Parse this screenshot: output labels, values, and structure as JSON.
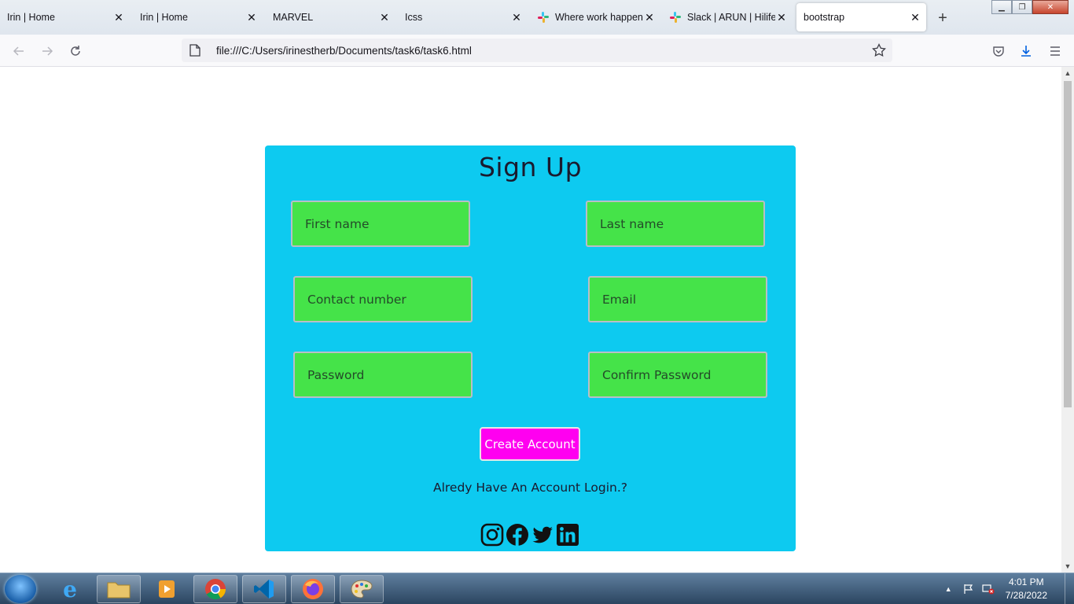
{
  "browser": {
    "tabs": [
      {
        "title": "Irin | Home",
        "active": false
      },
      {
        "title": "Irin | Home",
        "active": false
      },
      {
        "title": "MARVEL",
        "active": false
      },
      {
        "title": "Icss",
        "active": false
      },
      {
        "title": "Where work happens",
        "active": false
      },
      {
        "title": "Slack | ARUN | HilifeAI",
        "active": false
      },
      {
        "title": "bootstrap",
        "active": true
      }
    ],
    "url": "file:///C:/Users/irinestherb/Documents/task6/task6.html"
  },
  "signup": {
    "title": "Sign Up",
    "fields": {
      "first_name": "First name",
      "last_name": "Last name",
      "contact": "Contact number",
      "email": "Email",
      "password": "Password",
      "confirm_password": "Confirm Password"
    },
    "create_button": "Create Account",
    "login_text": "Alredy Have An Account Login.?",
    "social_icons": [
      "instagram-icon",
      "facebook-icon",
      "twitter-icon",
      "linkedin-icon"
    ]
  },
  "taskbar": {
    "apps": [
      "internet-explorer",
      "file-explorer",
      "media-player",
      "chrome",
      "vscode",
      "firefox",
      "paint"
    ],
    "time": "4:01 PM",
    "date": "7/28/2022"
  },
  "colors": {
    "card": "#0dcaf0",
    "field": "#45e349",
    "button": "#ff00f0"
  }
}
